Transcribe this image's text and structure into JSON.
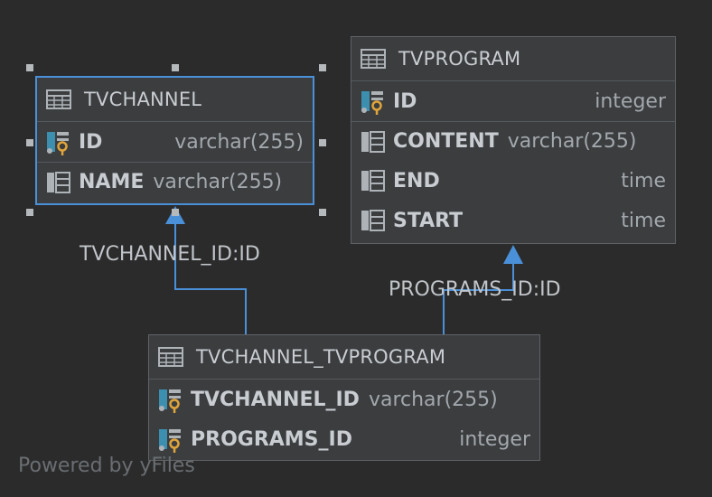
{
  "tables": {
    "tvchannel": {
      "title": "TVCHANNEL",
      "columns": [
        {
          "name": "ID",
          "type": "varchar(255)",
          "icon": "primary-key-column-icon"
        },
        {
          "name": "NAME",
          "type": "varchar(255)",
          "icon": "column-icon"
        }
      ]
    },
    "tvprogram": {
      "title": "TVPROGRAM",
      "columns": [
        {
          "name": "ID",
          "type": "integer",
          "icon": "primary-key-column-icon"
        },
        {
          "name": "CONTENT",
          "type": "varchar(255)",
          "icon": "column-icon"
        },
        {
          "name": "END",
          "type": "time",
          "icon": "column-icon"
        },
        {
          "name": "START",
          "type": "time",
          "icon": "column-icon"
        }
      ]
    },
    "join": {
      "title": "TVCHANNEL_TVPROGRAM",
      "columns": [
        {
          "name": "TVCHANNEL_ID",
          "type": "varchar(255)",
          "icon": "primary-foreign-key-column-icon"
        },
        {
          "name": "PROGRAMS_ID",
          "type": "integer",
          "icon": "primary-foreign-key-column-icon"
        }
      ]
    }
  },
  "relations": {
    "to_channel_label": "TVCHANNEL_ID:ID",
    "to_program_label": "PROGRAMS_ID:ID"
  },
  "watermark": "Powered by yFiles",
  "colors": {
    "background": "#2b2b2b",
    "selection": "#4a90d9",
    "table_bg": "#3b3d3f",
    "key_gold": "#e0a43a",
    "key_teal": "#3d8fb0"
  }
}
